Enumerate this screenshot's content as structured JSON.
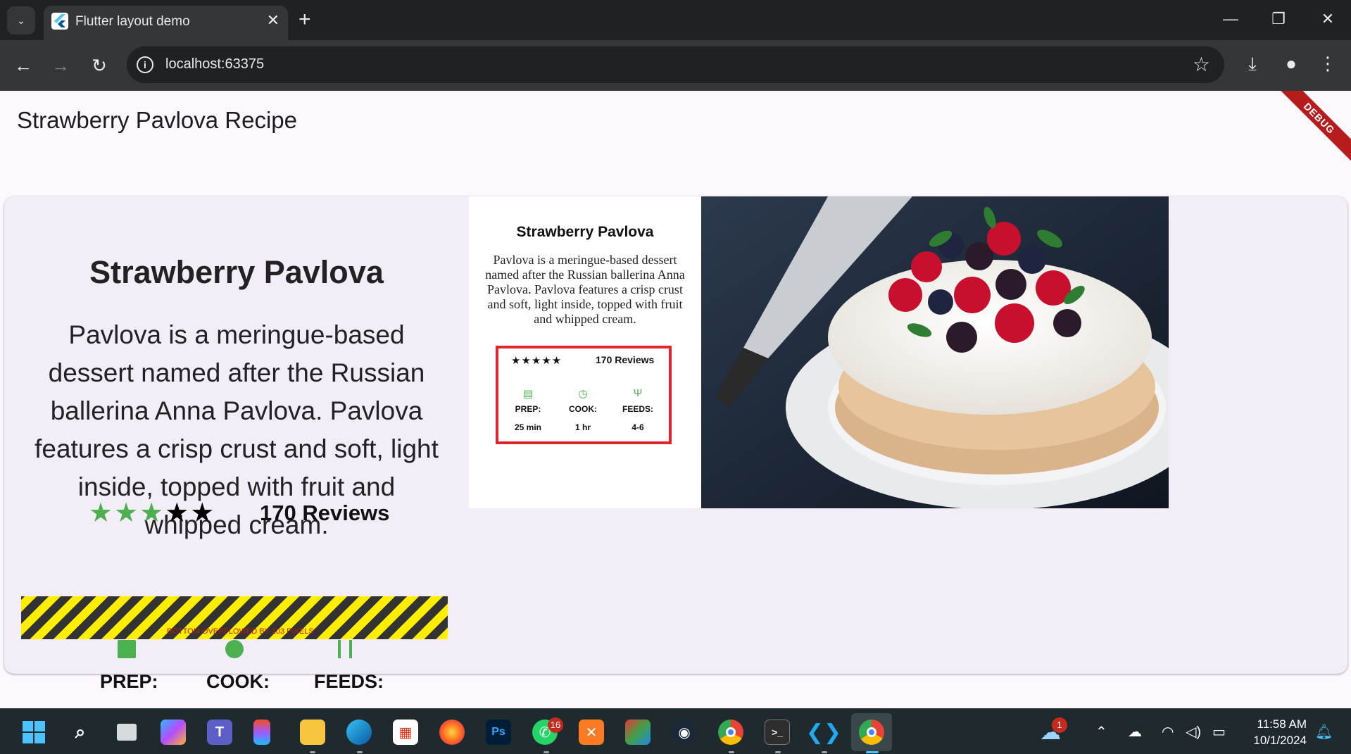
{
  "browser": {
    "tab_title": "Flutter layout demo",
    "url": "localhost:63375",
    "icons": {
      "tab_search": "chevron-down-icon",
      "close_tab": "close-icon",
      "new_tab": "plus-icon",
      "back": "back-arrow-icon",
      "forward": "forward-arrow-icon",
      "reload": "reload-icon",
      "site_info": "info-icon",
      "bookmark": "star-icon",
      "downloads": "download-icon",
      "profile": "profile-icon",
      "menu": "more-vert-icon"
    }
  },
  "app": {
    "appbar_title": "Strawberry Pavlova Recipe",
    "debug_banner": "DEBUG",
    "recipe": {
      "title": "Strawberry Pavlova",
      "description": "Pavlova is a meringue-based dessert named after the Russian ballerina Anna Pavlova. Pavlova features a crisp crust and soft, light inside, topped with fruit and whipped cream.",
      "rating": {
        "filled_green": 3,
        "filled_black": 2,
        "total": 5
      },
      "stars_green": "★★★",
      "stars_black": "★★",
      "reviews": "170 Reviews",
      "overflow_message": "BOTTOM OVERFLOWED BY 103 PIXELS",
      "info_labels": {
        "prep": "PREP:",
        "cook": "COOK:",
        "feeds": "FEEDS:"
      }
    },
    "image_card": {
      "title": "Strawberry Pavlova",
      "description": "Pavlova is a meringue-based dessert named after the Russian ballerina Anna Pavlova. Pavlova features a crisp crust and soft, light inside, topped with fruit and whipped cream.",
      "stars": "★★★★★",
      "reviews": "170 Reviews",
      "prep_label": "PREP:",
      "prep_value": "25 min",
      "cook_label": "COOK:",
      "cook_value": "1 hr",
      "feeds_label": "FEEDS:",
      "feeds_value": "4-6"
    }
  },
  "taskbar": {
    "apps": [
      "windows-start",
      "search",
      "task-view",
      "copilot",
      "teams",
      "figma",
      "file-explorer",
      "edge",
      "store",
      "firefox",
      "photoshop",
      "whatsapp",
      "xampp",
      "app-ps",
      "steam",
      "chrome",
      "terminal",
      "vscode",
      "chrome-active"
    ],
    "whatsapp_badge": "16",
    "weather_badge": "1",
    "time": "11:58 AM",
    "date": "10/1/2024"
  },
  "colors": {
    "accent_green": "#4caf50",
    "overflow_stripe_yellow": "#ffee00",
    "border_red": "#e0252e",
    "debug_red": "#b71c1c"
  }
}
